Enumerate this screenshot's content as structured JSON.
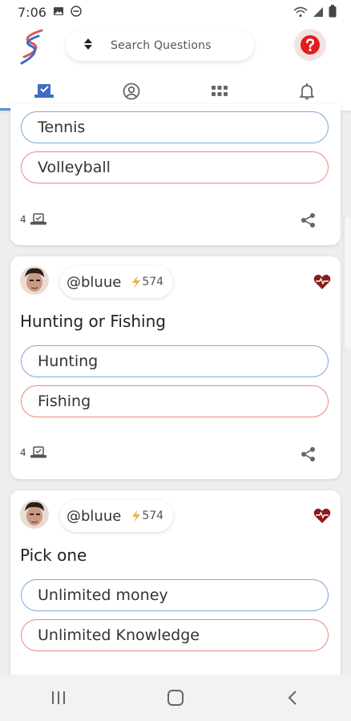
{
  "status": {
    "time": "7:06"
  },
  "search": {
    "placeholder": "Search Questions"
  },
  "tabs": [
    "questions",
    "profile",
    "apps",
    "notifications"
  ],
  "colors": {
    "accent": "#5b8fd6",
    "option_blue": "#7ea6dc",
    "option_red": "#e98a7f",
    "heart": "#8b1a1a"
  },
  "cards": [
    {
      "options": [
        "Tennis",
        "Volleyball"
      ],
      "votes": "4"
    },
    {
      "user": "@bluue",
      "points": "574",
      "question": "Hunting or Fishing",
      "options": [
        "Hunting",
        "Fishing"
      ],
      "votes": "4"
    },
    {
      "user": "@bluue",
      "points": "574",
      "question": "Pick one",
      "options": [
        "Unlimited money",
        "Unlimited Knowledge"
      ]
    }
  ]
}
